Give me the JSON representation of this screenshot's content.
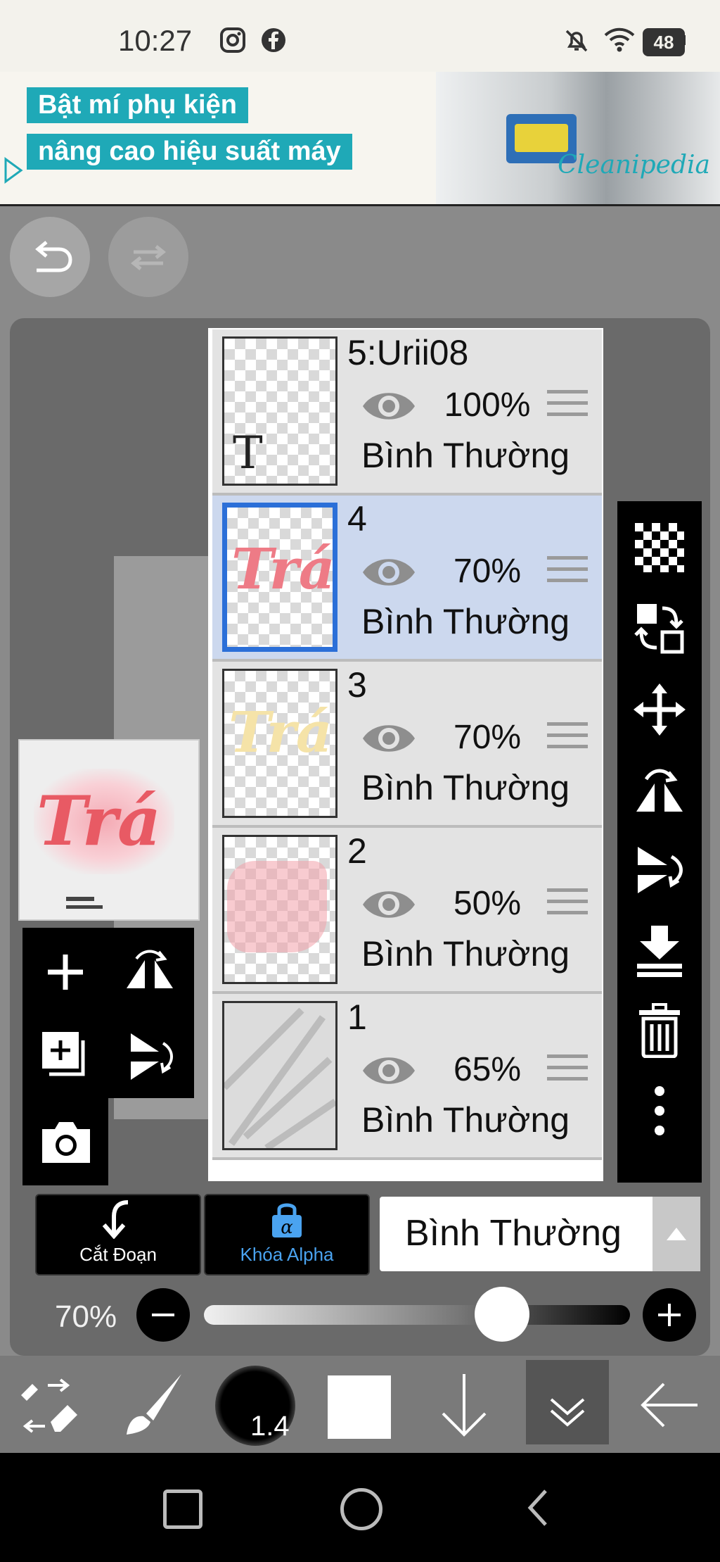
{
  "status_bar": {
    "time": "10:27",
    "battery": "48",
    "icons": [
      "instagram-icon",
      "facebook-icon",
      "mute-icon",
      "wifi-icon",
      "battery-icon"
    ]
  },
  "ad": {
    "line1": "Bật mí phụ kiện",
    "line2": "nâng cao hiệu suất máy",
    "brand": "Cleanipedia"
  },
  "layers": [
    {
      "name": "5:Urii08",
      "opacity": "100%",
      "blend": "Bình Thường",
      "selected": false,
      "thumb": "text-layer"
    },
    {
      "name": "4",
      "opacity": "70%",
      "blend": "Bình Thường",
      "selected": true,
      "thumb": "pink-lettering"
    },
    {
      "name": "3",
      "opacity": "70%",
      "blend": "Bình Thường",
      "selected": false,
      "thumb": "yellow-lettering"
    },
    {
      "name": "2",
      "opacity": "50%",
      "blend": "Bình Thường",
      "selected": false,
      "thumb": "pink-blob"
    },
    {
      "name": "1",
      "opacity": "65%",
      "blend": "Bình Thường",
      "selected": false,
      "thumb": "palm-shadow"
    }
  ],
  "text_layer_glyph": "T",
  "thumb_text": "Trá",
  "bottom": {
    "clip_label": "Cắt Đoạn",
    "alpha_lock_label": "Khóa Alpha",
    "blend_mode": "Bình Thường",
    "opacity_pct": "70%",
    "opacity_value": 0.7,
    "brush_size": "1.4"
  },
  "colors": {
    "selected_layer": "#ccd8ee",
    "selected_border": "#2b6fd8",
    "alpha_lock": "#4aa3f0",
    "ad_teal": "#1fa9b7"
  }
}
